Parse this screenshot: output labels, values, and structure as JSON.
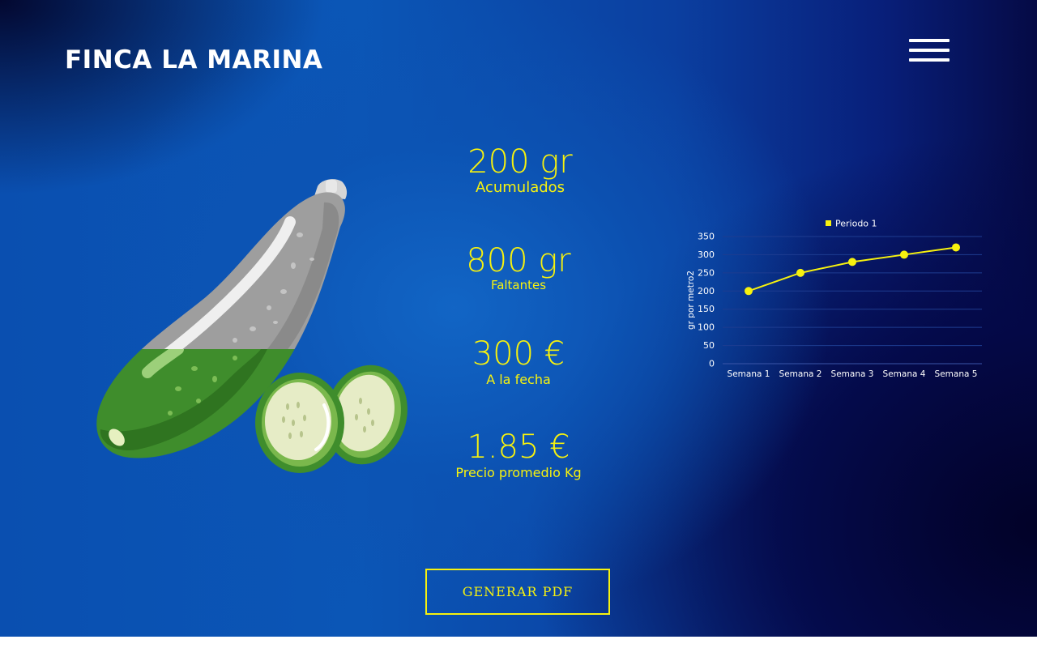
{
  "header": {
    "title": "FINCA LA MARINA"
  },
  "stats": [
    {
      "value": "200 gr",
      "label": "Acumulados"
    },
    {
      "value": "800 gr",
      "label": "Faltantes"
    },
    {
      "value": "300 €",
      "label": "A la fecha"
    },
    {
      "value": "1.85 €",
      "label": "Precio promedio Kg"
    }
  ],
  "actions": {
    "pdf_label": "GENERAR PDF"
  },
  "colors": {
    "accent": "#f7f20e",
    "text": "#ffffff"
  },
  "icons": {
    "menu": "hamburger-menu-icon",
    "illustration": "zucchini-illustration"
  },
  "chart_data": {
    "type": "line",
    "categories": [
      "Semana 1",
      "Semana 2",
      "Semana 3",
      "Semana 4",
      "Semana 5"
    ],
    "series": [
      {
        "name": "Periodo 1",
        "values": [
          200,
          250,
          280,
          300,
          320
        ]
      }
    ],
    "ylabel": "gr por metro2",
    "xlabel": "",
    "ylim": [
      0,
      350
    ],
    "yticks": [
      0,
      50,
      100,
      150,
      200,
      250,
      300,
      350
    ],
    "grid": true,
    "legend": "top",
    "color": "#f7f20e"
  }
}
